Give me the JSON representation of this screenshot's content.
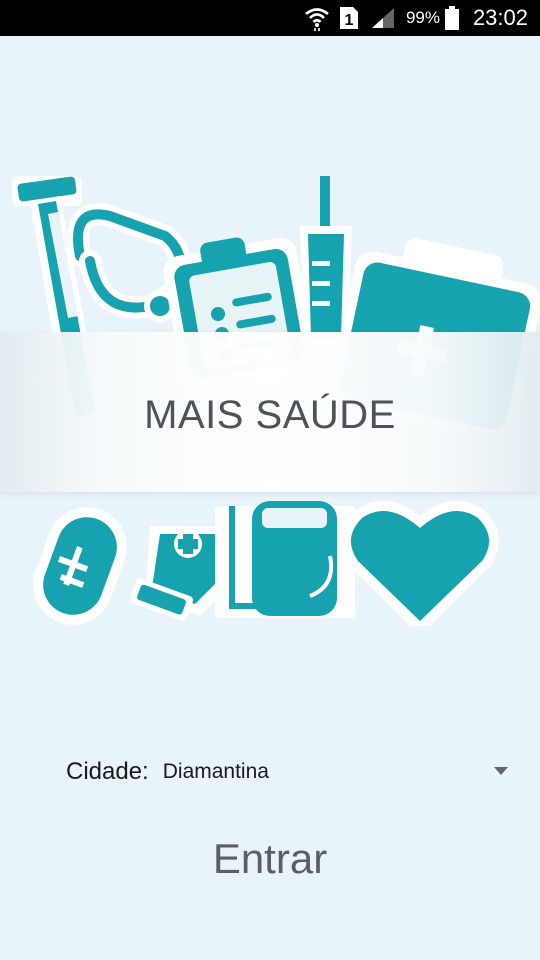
{
  "status_bar": {
    "time": "23:02",
    "battery_percent": "99%",
    "sim_slot": "1",
    "icons": [
      "wifi-icon",
      "sim-icon",
      "signal-icon",
      "battery-icon"
    ]
  },
  "app": {
    "title": "MAIS SAÚDE",
    "city_label": "Cidade:",
    "city_value": "Diamantina",
    "enter_label": "Entrar",
    "colors": {
      "background": "#e8f4fa",
      "accent": "#16a2ae",
      "text_dark": "#4d5356"
    },
    "illustration_icons": [
      "test-tube-icon",
      "stethoscope-icon",
      "clipboard-icon",
      "syringe-icon",
      "first-aid-kit-icon",
      "thermometer-icon",
      "medicine-bottle-icon",
      "iv-bag-icon",
      "heart-icon"
    ]
  }
}
